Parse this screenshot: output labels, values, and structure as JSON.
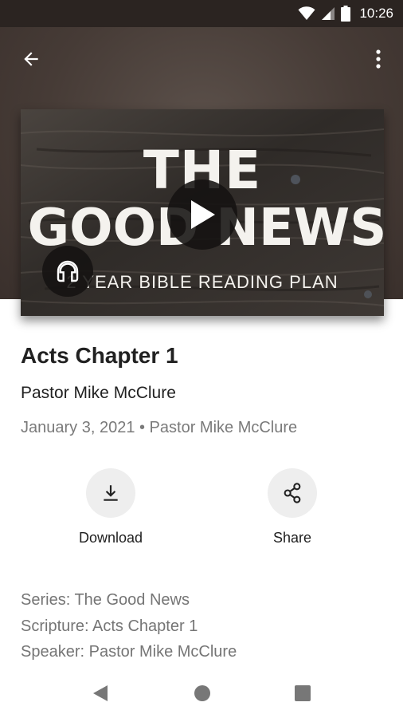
{
  "status_bar": {
    "time": "10:26",
    "icons": [
      "wifi-icon",
      "cellular-signal-icon",
      "battery-icon"
    ]
  },
  "app_bar": {
    "back_icon": "arrow-back-icon",
    "menu_icon": "more-vert-icon"
  },
  "artwork": {
    "line1": "THE",
    "line2": "GOOD NEWS",
    "line3": "2 YEAR BIBLE READING PLAN",
    "play_icon": "play-icon",
    "audio_icon": "headphones-icon"
  },
  "sermon": {
    "title": "Acts Chapter 1",
    "speaker": "Pastor Mike McClure",
    "meta": "January 3, 2021 • Pastor Mike McClure"
  },
  "actions": {
    "download_label": "Download",
    "share_label": "Share"
  },
  "details": {
    "series": "Series: The Good News",
    "scripture": "Scripture: Acts Chapter 1",
    "speaker": "Speaker: Pastor Mike McClure"
  },
  "colors": {
    "header_bg": "#463b36",
    "status_bar_bg": "#2b2421",
    "action_circle_bg": "#eeeeee",
    "secondary_text": "#757575"
  }
}
